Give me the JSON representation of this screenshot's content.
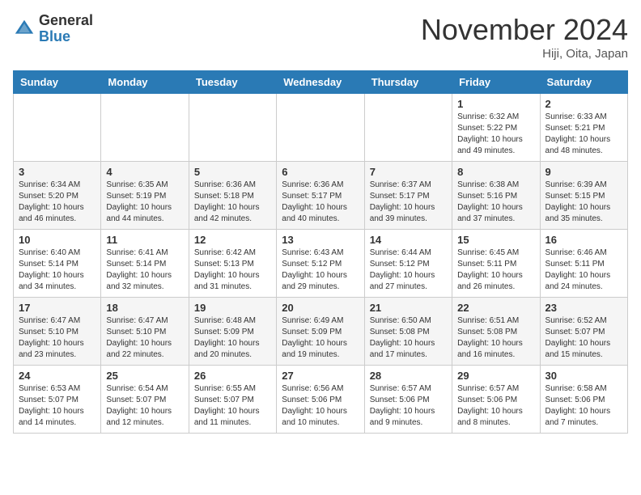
{
  "header": {
    "logo_general": "General",
    "logo_blue": "Blue",
    "month_title": "November 2024",
    "location": "Hiji, Oita, Japan"
  },
  "days_of_week": [
    "Sunday",
    "Monday",
    "Tuesday",
    "Wednesday",
    "Thursday",
    "Friday",
    "Saturday"
  ],
  "weeks": [
    [
      {
        "day": "",
        "info": ""
      },
      {
        "day": "",
        "info": ""
      },
      {
        "day": "",
        "info": ""
      },
      {
        "day": "",
        "info": ""
      },
      {
        "day": "",
        "info": ""
      },
      {
        "day": "1",
        "info": "Sunrise: 6:32 AM\nSunset: 5:22 PM\nDaylight: 10 hours and 49 minutes."
      },
      {
        "day": "2",
        "info": "Sunrise: 6:33 AM\nSunset: 5:21 PM\nDaylight: 10 hours and 48 minutes."
      }
    ],
    [
      {
        "day": "3",
        "info": "Sunrise: 6:34 AM\nSunset: 5:20 PM\nDaylight: 10 hours and 46 minutes."
      },
      {
        "day": "4",
        "info": "Sunrise: 6:35 AM\nSunset: 5:19 PM\nDaylight: 10 hours and 44 minutes."
      },
      {
        "day": "5",
        "info": "Sunrise: 6:36 AM\nSunset: 5:18 PM\nDaylight: 10 hours and 42 minutes."
      },
      {
        "day": "6",
        "info": "Sunrise: 6:36 AM\nSunset: 5:17 PM\nDaylight: 10 hours and 40 minutes."
      },
      {
        "day": "7",
        "info": "Sunrise: 6:37 AM\nSunset: 5:17 PM\nDaylight: 10 hours and 39 minutes."
      },
      {
        "day": "8",
        "info": "Sunrise: 6:38 AM\nSunset: 5:16 PM\nDaylight: 10 hours and 37 minutes."
      },
      {
        "day": "9",
        "info": "Sunrise: 6:39 AM\nSunset: 5:15 PM\nDaylight: 10 hours and 35 minutes."
      }
    ],
    [
      {
        "day": "10",
        "info": "Sunrise: 6:40 AM\nSunset: 5:14 PM\nDaylight: 10 hours and 34 minutes."
      },
      {
        "day": "11",
        "info": "Sunrise: 6:41 AM\nSunset: 5:14 PM\nDaylight: 10 hours and 32 minutes."
      },
      {
        "day": "12",
        "info": "Sunrise: 6:42 AM\nSunset: 5:13 PM\nDaylight: 10 hours and 31 minutes."
      },
      {
        "day": "13",
        "info": "Sunrise: 6:43 AM\nSunset: 5:12 PM\nDaylight: 10 hours and 29 minutes."
      },
      {
        "day": "14",
        "info": "Sunrise: 6:44 AM\nSunset: 5:12 PM\nDaylight: 10 hours and 27 minutes."
      },
      {
        "day": "15",
        "info": "Sunrise: 6:45 AM\nSunset: 5:11 PM\nDaylight: 10 hours and 26 minutes."
      },
      {
        "day": "16",
        "info": "Sunrise: 6:46 AM\nSunset: 5:11 PM\nDaylight: 10 hours and 24 minutes."
      }
    ],
    [
      {
        "day": "17",
        "info": "Sunrise: 6:47 AM\nSunset: 5:10 PM\nDaylight: 10 hours and 23 minutes."
      },
      {
        "day": "18",
        "info": "Sunrise: 6:47 AM\nSunset: 5:10 PM\nDaylight: 10 hours and 22 minutes."
      },
      {
        "day": "19",
        "info": "Sunrise: 6:48 AM\nSunset: 5:09 PM\nDaylight: 10 hours and 20 minutes."
      },
      {
        "day": "20",
        "info": "Sunrise: 6:49 AM\nSunset: 5:09 PM\nDaylight: 10 hours and 19 minutes."
      },
      {
        "day": "21",
        "info": "Sunrise: 6:50 AM\nSunset: 5:08 PM\nDaylight: 10 hours and 17 minutes."
      },
      {
        "day": "22",
        "info": "Sunrise: 6:51 AM\nSunset: 5:08 PM\nDaylight: 10 hours and 16 minutes."
      },
      {
        "day": "23",
        "info": "Sunrise: 6:52 AM\nSunset: 5:07 PM\nDaylight: 10 hours and 15 minutes."
      }
    ],
    [
      {
        "day": "24",
        "info": "Sunrise: 6:53 AM\nSunset: 5:07 PM\nDaylight: 10 hours and 14 minutes."
      },
      {
        "day": "25",
        "info": "Sunrise: 6:54 AM\nSunset: 5:07 PM\nDaylight: 10 hours and 12 minutes."
      },
      {
        "day": "26",
        "info": "Sunrise: 6:55 AM\nSunset: 5:07 PM\nDaylight: 10 hours and 11 minutes."
      },
      {
        "day": "27",
        "info": "Sunrise: 6:56 AM\nSunset: 5:06 PM\nDaylight: 10 hours and 10 minutes."
      },
      {
        "day": "28",
        "info": "Sunrise: 6:57 AM\nSunset: 5:06 PM\nDaylight: 10 hours and 9 minutes."
      },
      {
        "day": "29",
        "info": "Sunrise: 6:57 AM\nSunset: 5:06 PM\nDaylight: 10 hours and 8 minutes."
      },
      {
        "day": "30",
        "info": "Sunrise: 6:58 AM\nSunset: 5:06 PM\nDaylight: 10 hours and 7 minutes."
      }
    ]
  ]
}
